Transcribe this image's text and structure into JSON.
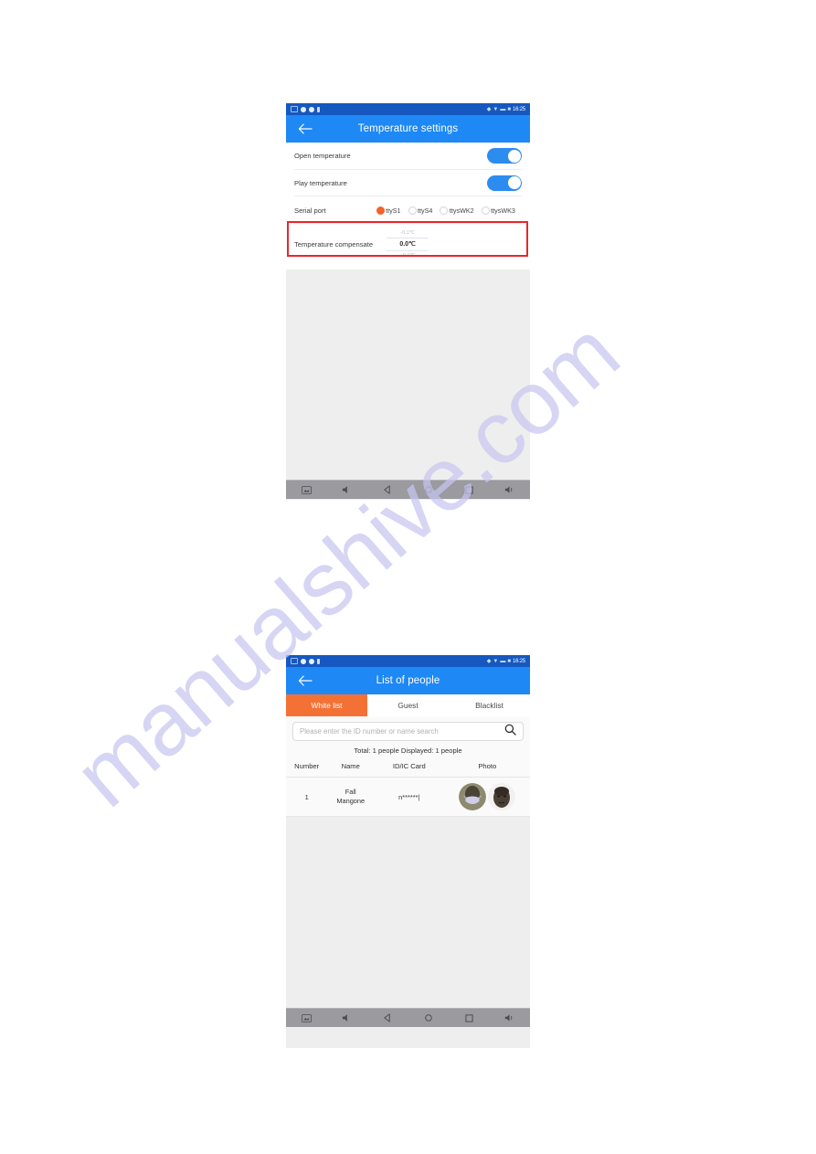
{
  "page": {
    "watermark": "manualshive.com",
    "background_color": "#ffffff"
  },
  "colors": {
    "appbar_blue": "#1e88f5",
    "statusbar_blue": "#1558c0",
    "accent_orange": "#f47135",
    "radio_orange": "#f4632a",
    "toggle_blue": "#2d8cf0",
    "highlight_red": "#e8262c",
    "screen_gray": "#eeeeee",
    "navbar_gray": "#9a9a9f"
  },
  "screens": [
    {
      "id": "temperature-settings",
      "statusbar": {
        "time": "16:25",
        "left_icons": [
          "message-icon",
          "dot-icon",
          "dot-icon",
          "pin-icon"
        ],
        "right_icons": [
          "bluetooth-icon",
          "wifi-icon",
          "signal-icon",
          "battery-icon"
        ]
      },
      "appbar": {
        "title": "Temperature settings",
        "back_icon": "back-arrow-icon"
      },
      "rows": [
        {
          "label": "Open temperature",
          "control": "toggle",
          "value": "on"
        },
        {
          "label": "Play temperature",
          "control": "toggle",
          "value": "on"
        }
      ],
      "serial_port": {
        "label": "Serial port",
        "options": [
          {
            "label": "ttyS1",
            "selected": true
          },
          {
            "label": "ttyS4",
            "selected": false
          },
          {
            "label": "ttysWK2",
            "selected": false
          },
          {
            "label": "ttysWK3",
            "selected": false
          }
        ]
      },
      "temperature_compensate": {
        "label": "Temperature compensate",
        "above": "-0.1℃",
        "selected": "0.0℃",
        "below": "+0.1℃",
        "highlighted": true
      },
      "navbar": {
        "buttons": [
          "screenshot-icon",
          "volume-down-icon",
          "back-icon",
          "home-icon",
          "recents-icon",
          "volume-up-icon"
        ]
      }
    },
    {
      "id": "list-of-people",
      "statusbar": {
        "time": "16:25",
        "left_icons": [
          "message-icon",
          "dot-icon",
          "dot-icon",
          "pin-icon"
        ],
        "right_icons": [
          "bluetooth-icon",
          "wifi-icon",
          "signal-icon",
          "battery-icon"
        ]
      },
      "appbar": {
        "title": "List of people",
        "back_icon": "back-arrow-icon"
      },
      "tabs": [
        {
          "label": "White list",
          "active": true
        },
        {
          "label": "Guest",
          "active": false
        },
        {
          "label": "Blacklist",
          "active": false
        }
      ],
      "search": {
        "value": "",
        "placeholder": "Please enter the ID number or name search",
        "icon": "search-icon"
      },
      "counts": "Total: 1 people   Displayed: 1 people",
      "table": {
        "columns": [
          "Number",
          "Name",
          "ID/IC Card",
          "Photo"
        ],
        "rows": [
          {
            "number": "1",
            "name_line1": "Fall",
            "name_line2": "Mangone",
            "id_card": "n******|",
            "photos": [
              "masked-face-photo",
              "face-photo"
            ]
          }
        ]
      },
      "navbar": {
        "buttons": [
          "screenshot-icon",
          "volume-down-icon",
          "back-icon",
          "home-icon",
          "recents-icon",
          "volume-up-icon"
        ]
      }
    }
  ]
}
